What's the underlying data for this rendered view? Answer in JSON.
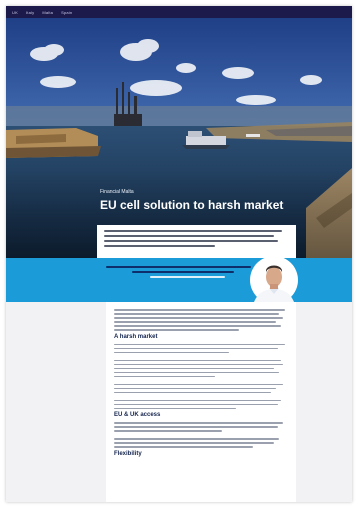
{
  "nav": {
    "items": [
      "UK",
      "Italy",
      "Malta",
      "Spain"
    ]
  },
  "hero": {
    "kicker": "Financial Malta",
    "title": "EU cell solution to harsh market"
  },
  "article": {
    "heading1": "A harsh market",
    "heading2": "EU & UK access",
    "heading3": "Flexibility"
  },
  "colors": {
    "nav": "#1c1a4a",
    "band": "#1b9bd8",
    "heading": "#14244d",
    "page": "#f2f2f4"
  }
}
